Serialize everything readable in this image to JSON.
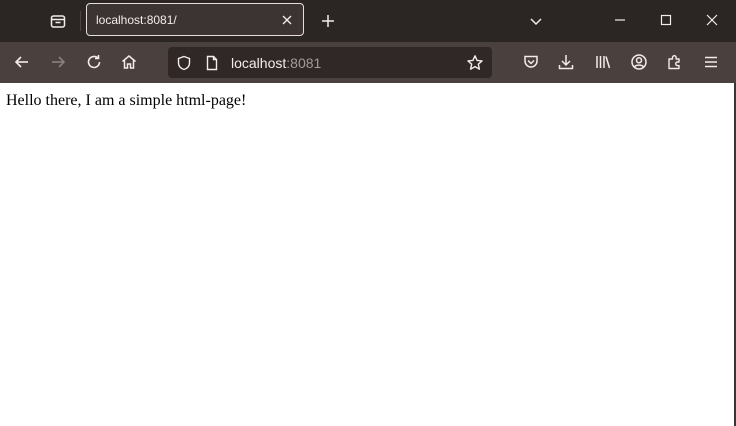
{
  "tab": {
    "title": "localhost:8081/"
  },
  "urlbar": {
    "host": "localhost",
    "port": ":8081"
  },
  "page": {
    "text": "Hello there, I am a simple html-page!"
  },
  "icons": {
    "tab_manager": "firefox-view-icon",
    "tab_close": "close-icon",
    "new_tab": "plus-icon",
    "tab_list": "chevron-down-icon",
    "minimize": "minimize-icon",
    "maximize": "maximize-icon",
    "close_window": "close-icon",
    "back": "arrow-left-icon",
    "forward": "arrow-right-icon",
    "reload": "reload-icon",
    "home": "home-icon",
    "tracking_protection": "shield-icon",
    "page_info": "page-icon",
    "bookmark": "star-icon",
    "pocket": "pocket-icon",
    "downloads": "download-icon",
    "library": "library-icon",
    "account": "account-icon",
    "extensions": "puzzle-icon",
    "menu": "hamburger-icon"
  },
  "colors": {
    "tabbar_bg": "#2b2523",
    "navbar_bg": "#4a403e",
    "urlbar_bg": "#2f2826",
    "tab_bg": "#3b3433",
    "tab_border": "#e7ded8",
    "icon": "#f3ecea",
    "icon_disabled": "#8a807c"
  }
}
